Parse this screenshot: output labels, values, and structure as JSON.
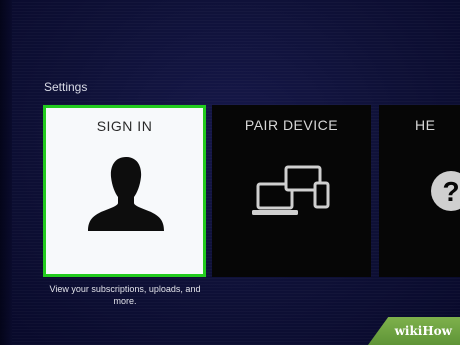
{
  "settings": {
    "section_title": "Settings",
    "tiles": [
      {
        "label": "SIGN IN",
        "icon": "person-silhouette-icon",
        "selected": true,
        "caption": "View your subscriptions, uploads, and more."
      },
      {
        "label": "PAIR DEVICE",
        "icon": "devices-icon",
        "selected": false
      },
      {
        "label": "HE",
        "icon": "help-question-icon",
        "selected": false
      }
    ]
  },
  "colors": {
    "background": "#0e1036",
    "selected_border": "#22cc1e",
    "selected_tile": "#f7f9fb",
    "tile": "#060606"
  },
  "watermark": {
    "text": "wikiHow"
  }
}
